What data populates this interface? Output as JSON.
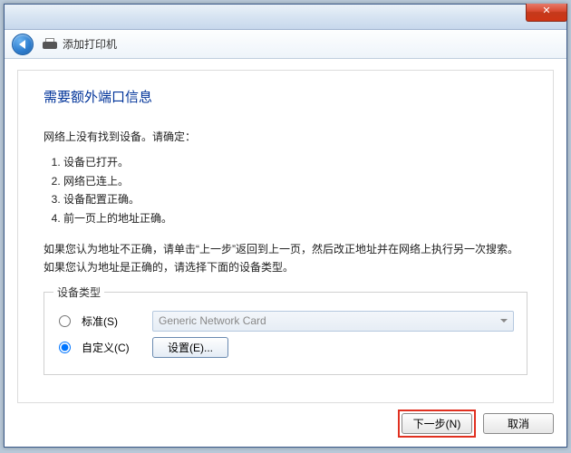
{
  "titlebar": {
    "close_glyph": "✕"
  },
  "header": {
    "title": "添加打印机"
  },
  "main": {
    "heading": "需要额外端口信息",
    "intro": "网络上没有找到设备。请确定：",
    "checklist": [
      "设备已打开。",
      "网络已连上。",
      "设备配置正确。",
      "前一页上的地址正确。"
    ],
    "advice": "如果您认为地址不正确，请单击“上一步”返回到上一页，然后改正地址并在网络上执行另一次搜索。如果您认为地址是正确的，请选择下面的设备类型。"
  },
  "device_group": {
    "legend": "设备类型",
    "standard_label": "标准(S)",
    "standard_value": "Generic Network Card",
    "custom_label": "自定义(C)",
    "settings_button": "设置(E)..."
  },
  "footer": {
    "next": "下一步(N)",
    "cancel": "取消"
  }
}
